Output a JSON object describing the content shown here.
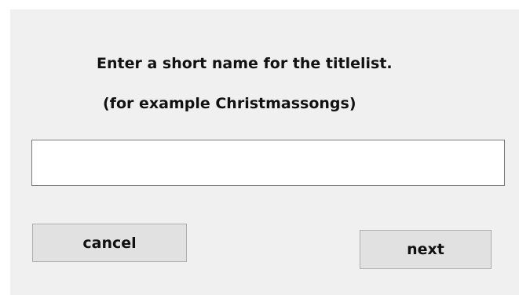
{
  "dialog": {
    "prompt_line1": "Enter a short name for the titlelist.",
    "prompt_line2": "(for example Christmassongs)",
    "name_input": {
      "value": "",
      "placeholder": ""
    },
    "cancel_label": "cancel",
    "next_label": "next"
  },
  "colors": {
    "dialog_background": "#f0f0f0",
    "button_face": "#e1e1e1",
    "button_border": "#adadad",
    "input_border": "#7a7a7a"
  }
}
